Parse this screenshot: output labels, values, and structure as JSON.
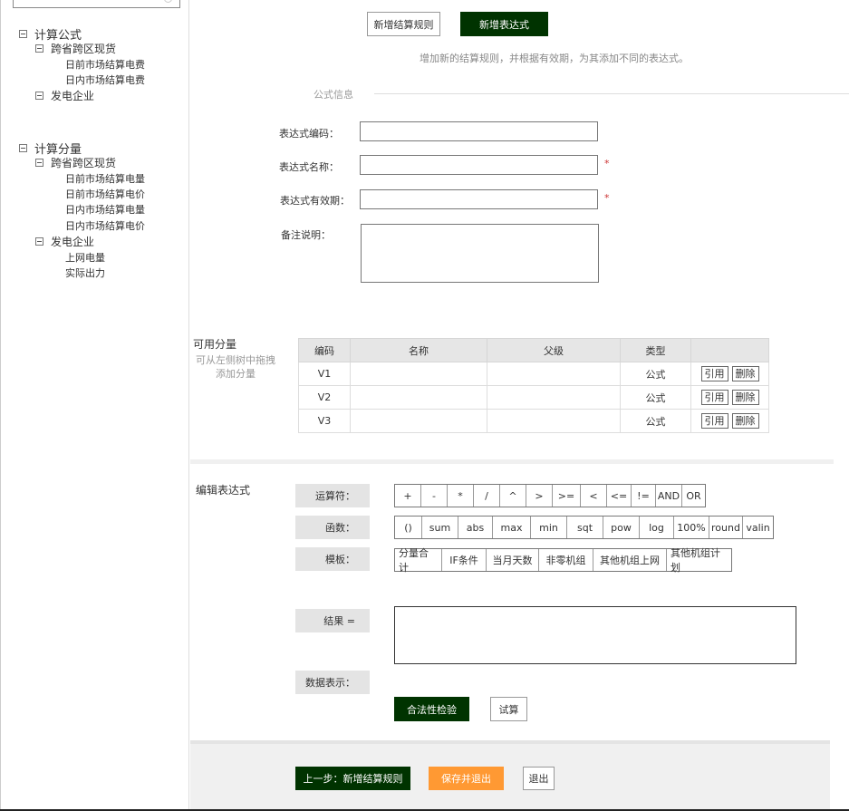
{
  "sidebar": {
    "search": {
      "placeholder": ""
    },
    "tree": [
      {
        "label": "计算公式",
        "level": 0
      },
      {
        "label": "跨省跨区现货",
        "level": 1
      },
      {
        "label": "日前市场结算电费",
        "level": 2
      },
      {
        "label": "日内市场结算电费",
        "level": 2
      },
      {
        "label": "发电企业",
        "level": 1
      },
      {
        "label": "计算分量",
        "level": 0
      },
      {
        "label": "跨省跨区现货",
        "level": 1
      },
      {
        "label": "日前市场结算电量",
        "level": 2
      },
      {
        "label": "日前市场结算电价",
        "level": 2
      },
      {
        "label": "日内市场结算电量",
        "level": 2
      },
      {
        "label": "日内市场结算电价",
        "level": 2
      },
      {
        "label": "发电企业",
        "level": 1
      },
      {
        "label": "上网电量",
        "level": 2
      },
      {
        "label": "实际出力",
        "level": 2
      }
    ]
  },
  "steps": {
    "step1_label": "新增结算规则",
    "step2_label": "新增表达式",
    "hint": "增加新的结算规则，并根据有效期，为其添加不同的表达式。"
  },
  "form": {
    "section_title": "公式信息",
    "code_label": "表达式编码：",
    "code_value": "",
    "name_label": "表达式名称：",
    "name_value": "",
    "period_label": "表达式有效期：",
    "period_value": "",
    "remark_label": "备注说明：",
    "remark_value": "",
    "required_mark": "*"
  },
  "variables": {
    "title": "可用分量",
    "subtitle": "可从左侧树中拖拽添加分量",
    "columns": [
      "编码",
      "名称",
      "父级",
      "类型",
      ""
    ],
    "rows": [
      {
        "code": "V1",
        "name": "",
        "parent": "",
        "type": "公式"
      },
      {
        "code": "V2",
        "name": "",
        "parent": "",
        "type": "公式"
      },
      {
        "code": "V3",
        "name": "",
        "parent": "",
        "type": "公式"
      }
    ],
    "ref_label": "引用",
    "delete_label": "删除"
  },
  "editor": {
    "title": "编辑表达式",
    "operators_label": "运算符：",
    "operators": [
      "+",
      "-",
      "*",
      "/",
      "^",
      ">",
      ">=",
      "<",
      "<=",
      "!=",
      "AND",
      "OR"
    ],
    "functions_label": "函数：",
    "functions": [
      "()",
      "sum",
      "abs",
      "max",
      "min",
      "sqt",
      "pow",
      "log",
      "100%",
      "round",
      "valin"
    ],
    "templates_label": "模板：",
    "templates": [
      "分量合计",
      "IF条件",
      "当月天数",
      "非零机组",
      "其他机组上网",
      "其他机组计划"
    ],
    "result_label": "结果 =",
    "result_value": "",
    "data_label": "数据表示：",
    "validate_label": "合法性检验",
    "trial_label": "试算"
  },
  "footer": {
    "prev_label": "上一步：新增结算规则",
    "save_label": "保存并退出",
    "exit_label": "退出"
  }
}
